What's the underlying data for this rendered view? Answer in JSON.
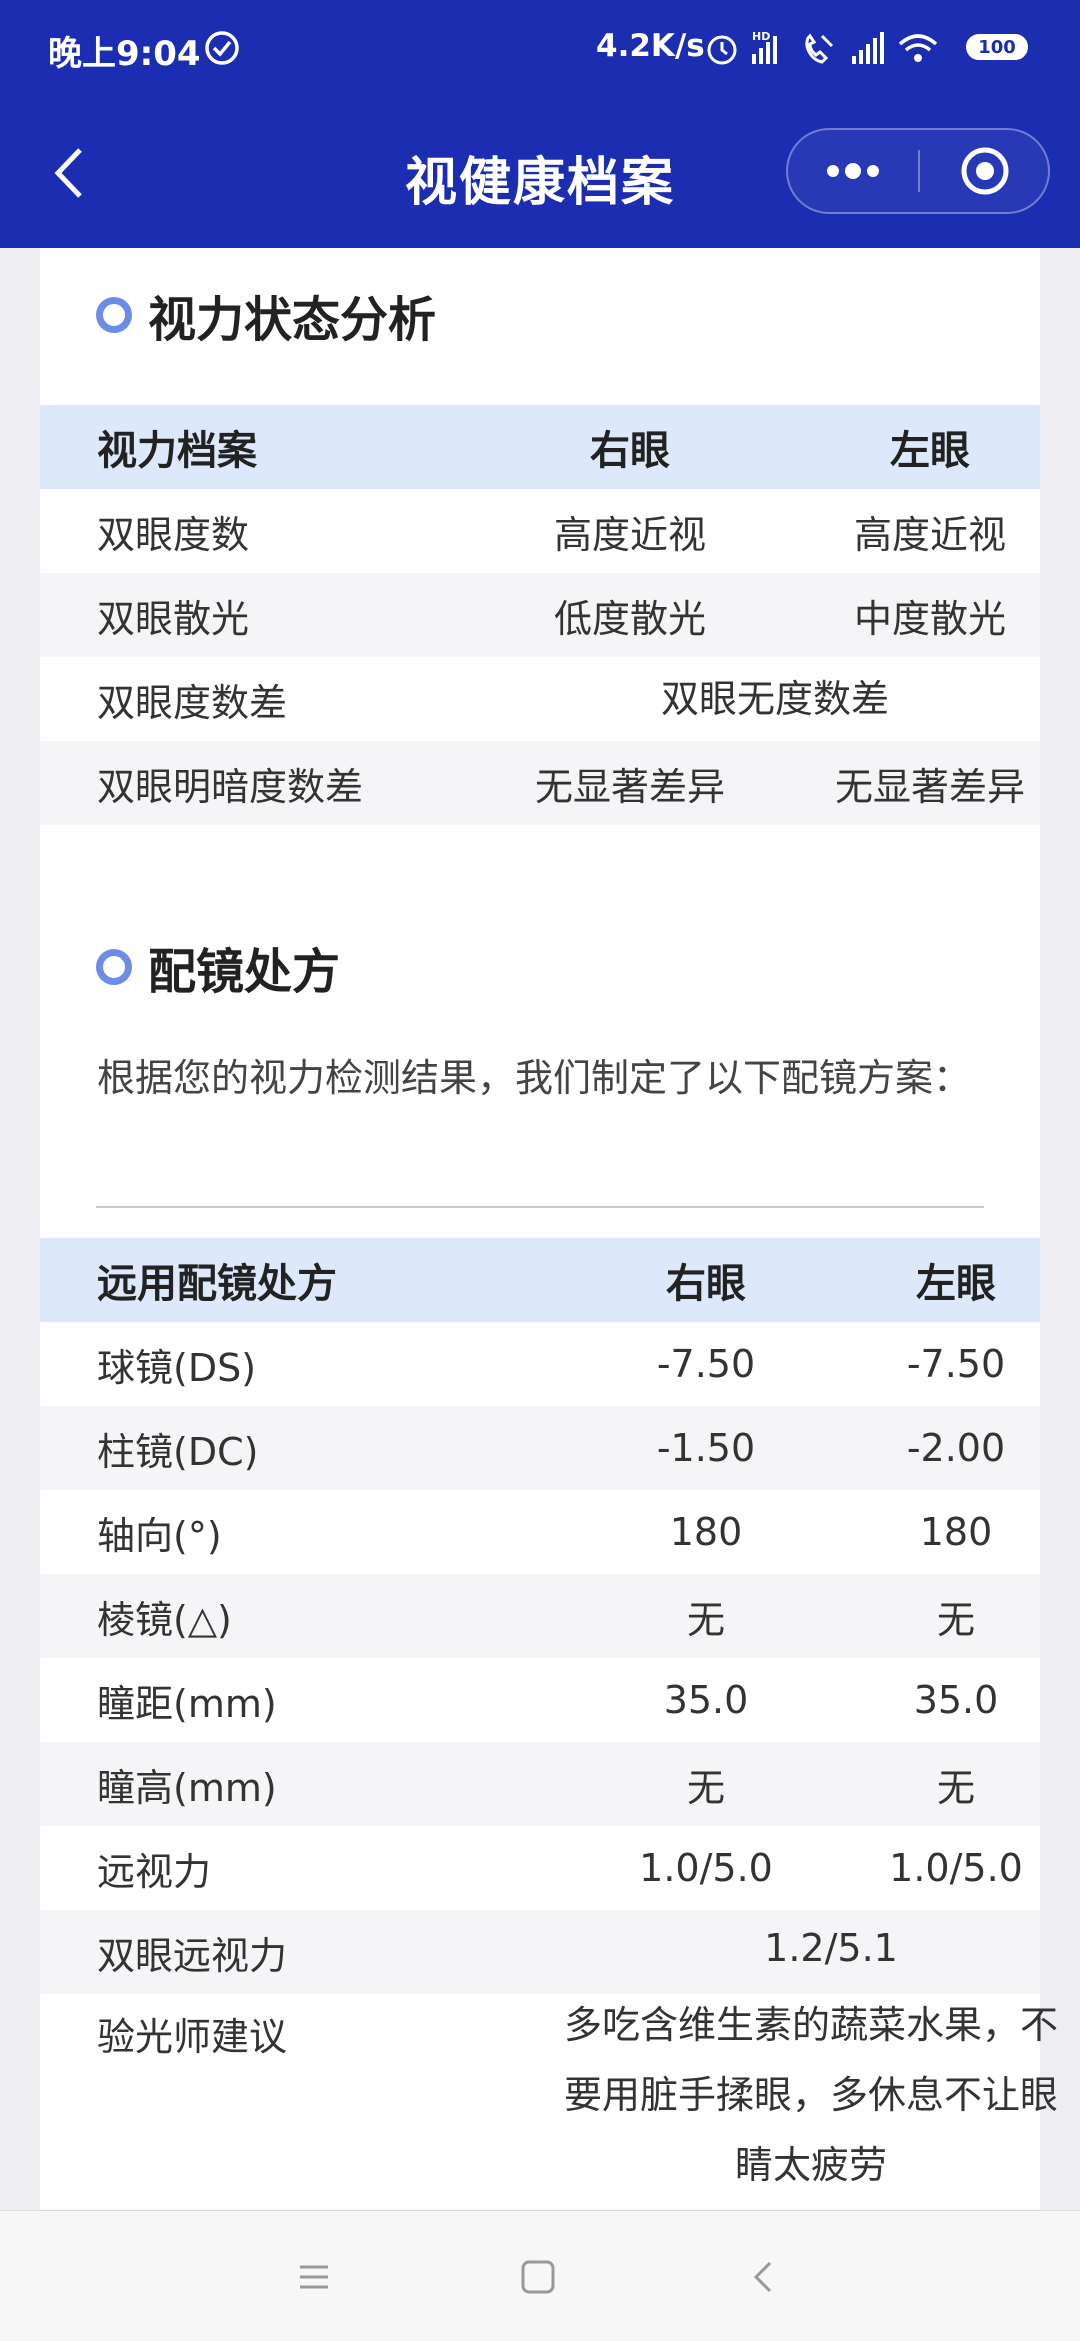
{
  "status_bar": {
    "time": "晚上9:04",
    "net_speed": "4.2K/s",
    "battery": "100",
    "icons": [
      "check-circle-icon",
      "alarm-icon",
      "hd-signal-icon",
      "call-icon",
      "signal-icon",
      "wifi-icon",
      "battery-icon"
    ]
  },
  "nav": {
    "title": "视健康档案",
    "icons": [
      "chevron-left-icon",
      "more-dots-icon",
      "target-close-icon"
    ]
  },
  "vision": {
    "section_title": "视力状态分析",
    "header": [
      "视力档案",
      "右眼",
      "左眼"
    ],
    "rows": [
      {
        "label": "双眼度数",
        "right": "高度近视",
        "left": "高度近视"
      },
      {
        "label": "双眼散光",
        "right": "低度散光",
        "left": "中度散光"
      },
      {
        "label": "双眼度数差",
        "both": "双眼无度数差"
      },
      {
        "label": "双眼明暗度数差",
        "right": "无显著差异",
        "left": "无显著差异"
      }
    ]
  },
  "prescription": {
    "section_title": "配镜处方",
    "intro": "根据您的视力检测结果，我们制定了以下配镜方案：",
    "header": [
      "远用配镜处方",
      "右眼",
      "左眼"
    ],
    "rows": [
      {
        "label": "球镜(DS)",
        "right": "-7.50",
        "left": "-7.50"
      },
      {
        "label": "柱镜(DC)",
        "right": "-1.50",
        "left": "-2.00"
      },
      {
        "label": "轴向(°)",
        "right": "180",
        "left": "180"
      },
      {
        "label": "棱镜(△)",
        "right": "无",
        "left": "无"
      },
      {
        "label": "瞳距(mm)",
        "right": "35.0",
        "left": "35.0"
      },
      {
        "label": "瞳高(mm)",
        "right": "无",
        "left": "无"
      },
      {
        "label": "远视力",
        "right": "1.0/5.0",
        "left": "1.0/5.0"
      },
      {
        "label": "双眼远视力",
        "both": "1.2/5.1"
      }
    ],
    "advice_label": "验光师建议",
    "advice_text": "多吃含维生素的蔬菜水果，不要用脏手揉眼，多休息不让眼睛太疲劳"
  },
  "system_nav": {
    "icons": [
      "menu-icon",
      "home-square-icon",
      "back-chevron-icon"
    ]
  },
  "colors": {
    "brand_blue": "#1b2db1",
    "header_row": "#dde8fb",
    "accent_dot": "#6d8ce6"
  }
}
